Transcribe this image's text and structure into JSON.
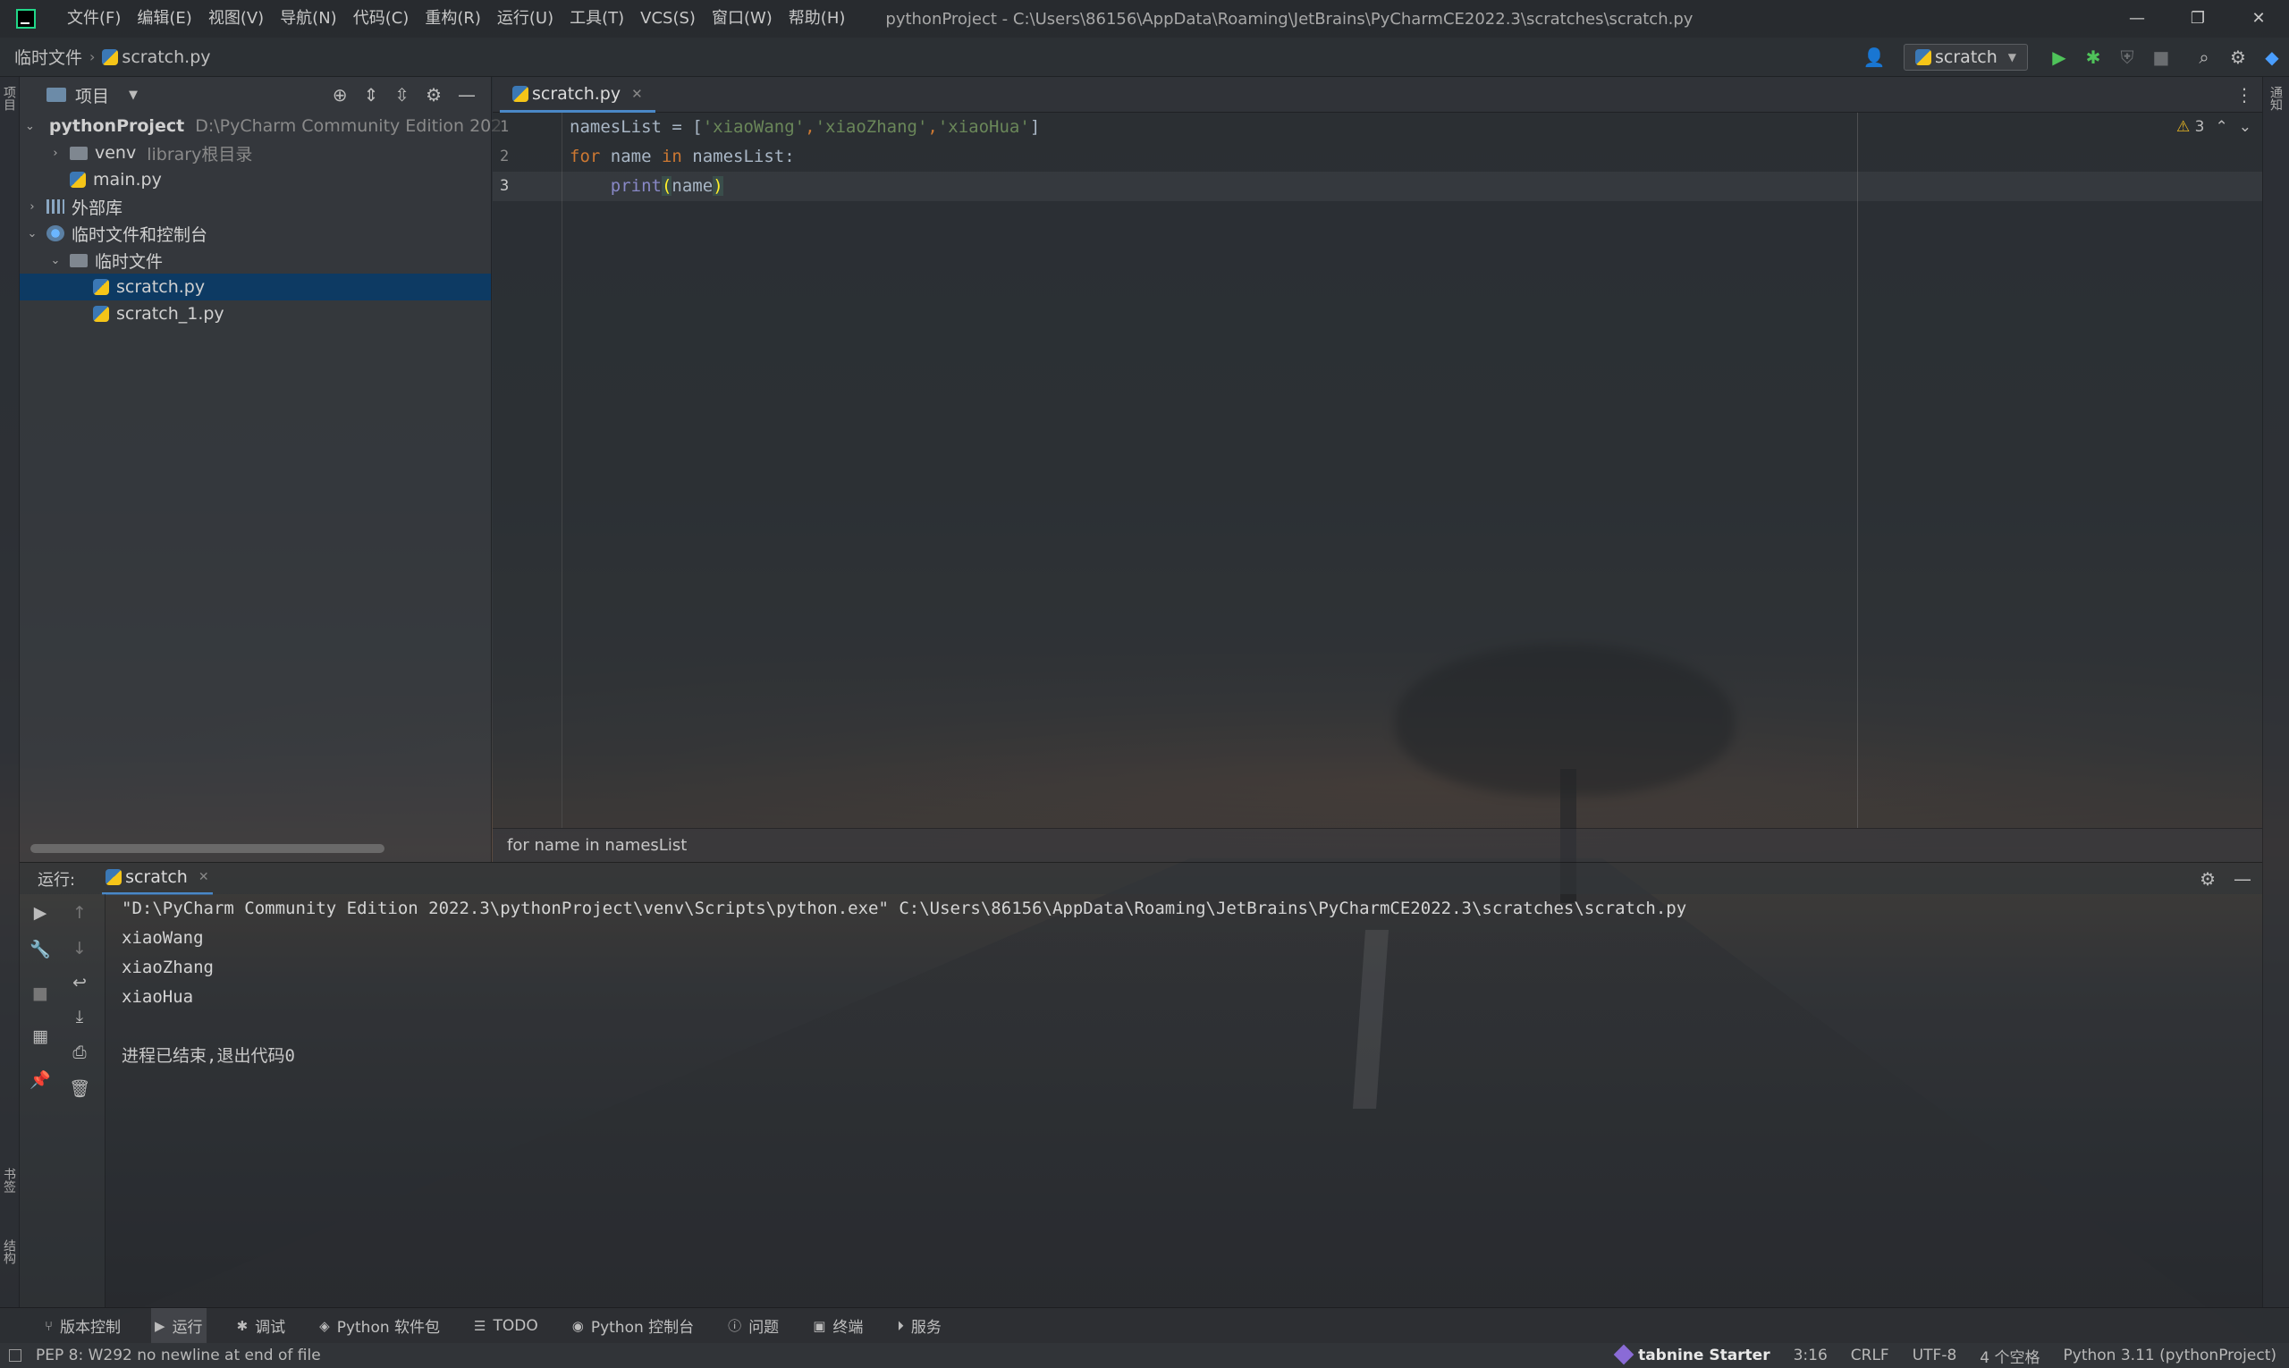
{
  "window": {
    "menu": [
      "文件(F)",
      "编辑(E)",
      "视图(V)",
      "导航(N)",
      "代码(C)",
      "重构(R)",
      "运行(U)",
      "工具(T)",
      "VCS(S)",
      "窗口(W)",
      "帮助(H)"
    ],
    "title": "pythonProject - C:\\Users\\86156\\AppData\\Roaming\\JetBrains\\PyCharmCE2022.3\\scratches\\scratch.py"
  },
  "navbar": {
    "breadcrumb_root": "临时文件",
    "breadcrumb_file": "scratch.py",
    "run_config": "scratch"
  },
  "left_strip": {
    "project_tab": "项目",
    "bookmarks_tab": "书签",
    "structure_tab": "结构"
  },
  "right_strip": {
    "notifications_tab": "通知"
  },
  "project_panel": {
    "title": "项目",
    "tree": [
      {
        "label": "pythonProject",
        "hint": "D:\\PyCharm Community Edition 202"
      },
      {
        "label": "venv",
        "hint": "library根目录"
      },
      {
        "label": "main.py",
        "hint": ""
      },
      {
        "label": "外部库",
        "hint": ""
      },
      {
        "label": "临时文件和控制台",
        "hint": ""
      },
      {
        "label": "临时文件",
        "hint": ""
      },
      {
        "label": "scratch.py",
        "hint": ""
      },
      {
        "label": "scratch_1.py",
        "hint": ""
      }
    ]
  },
  "editor": {
    "tab_label": "scratch.py",
    "line_numbers": [
      "1",
      "2",
      "3"
    ],
    "lines": [
      {
        "a": "namesList = [",
        "s1": "'xiaoWang'",
        "c1": ",",
        "s2": "'xiaoZhang'",
        "c2": ",",
        "s3": "'xiaoHua'",
        "b": "]"
      },
      {
        "kw1": "for",
        "m": " name ",
        "kw2": "in",
        "e": " namesList:"
      },
      {
        "indent": "    ",
        "fn": "print",
        "open": "(",
        "arg": "name",
        "close": ")"
      }
    ],
    "warning_count": "3",
    "breadcrumb": "for name in namesList"
  },
  "run_panel": {
    "label": "运行:",
    "tab": "scratch",
    "console_lines": [
      "\"D:\\PyCharm Community Edition 2022.3\\pythonProject\\venv\\Scripts\\python.exe\" C:\\Users\\86156\\AppData\\Roaming\\JetBrains\\PyCharmCE2022.3\\scratches\\scratch.py",
      "xiaoWang",
      "xiaoZhang",
      "xiaoHua",
      "",
      "进程已结束,退出代码0"
    ]
  },
  "tool_windows": [
    {
      "label": "版本控制",
      "icon": "branch-icon"
    },
    {
      "label": "运行",
      "icon": "run-icon"
    },
    {
      "label": "调试",
      "icon": "debug-icon"
    },
    {
      "label": "Python 软件包",
      "icon": "packages-icon"
    },
    {
      "label": "TODO",
      "icon": "list-icon"
    },
    {
      "label": "Python 控制台",
      "icon": "python-console-icon"
    },
    {
      "label": "问题",
      "icon": "info-icon"
    },
    {
      "label": "终端",
      "icon": "terminal-icon"
    },
    {
      "label": "服务",
      "icon": "services-icon"
    }
  ],
  "status": {
    "message": "PEP 8: W292 no newline at end of file",
    "tabnine": "tabnine Starter",
    "position": "3:16",
    "line_sep": "CRLF",
    "encoding": "UTF-8",
    "indent": "4 个空格",
    "interpreter": "Python 3.11 (pythonProject)"
  },
  "colors": {
    "keyword": "#cc7832",
    "string": "#6a8759",
    "builtin": "#8888c6",
    "selection": "#0d3a63",
    "accent": "#4a88c7",
    "run_green": "#4fc35a"
  }
}
